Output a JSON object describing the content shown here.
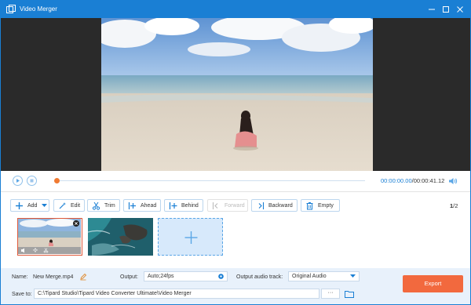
{
  "window": {
    "title": "Video Merger",
    "minimize_icon": "minimize-icon",
    "maximize_icon": "maximize-icon",
    "close_icon": "close-icon"
  },
  "player": {
    "current_time": "00:00:00.00",
    "duration": "/00:00:41.12",
    "progress": 0.0
  },
  "toolbar": {
    "add": "Add",
    "edit": "Edit",
    "trim": "Trim",
    "ahead": "Ahead",
    "behind": "Behind",
    "forward": "Forward",
    "backward": "Backward",
    "empty": "Empty",
    "page_current": "1",
    "page_total": "/2"
  },
  "clips": [
    {
      "name": "beach-clip",
      "selected": true
    },
    {
      "name": "aerial-coast-clip",
      "selected": false
    }
  ],
  "bottom": {
    "name_label": "Name:",
    "name_value": "New Merge.mp4",
    "output_label": "Output:",
    "output_value": "Auto;24fps",
    "audio_label": "Output audio track:",
    "audio_value": "Original Audio",
    "save_label": "Save to:",
    "save_path": "C:\\Tipard Studio\\Tipard Video Converter Ultimate\\Video Merger",
    "browse_label": "···",
    "export_label": "Export"
  },
  "colors": {
    "accent": "#1a7fd4",
    "export": "#f2693e",
    "bottom_bg": "#e8f1fb"
  }
}
